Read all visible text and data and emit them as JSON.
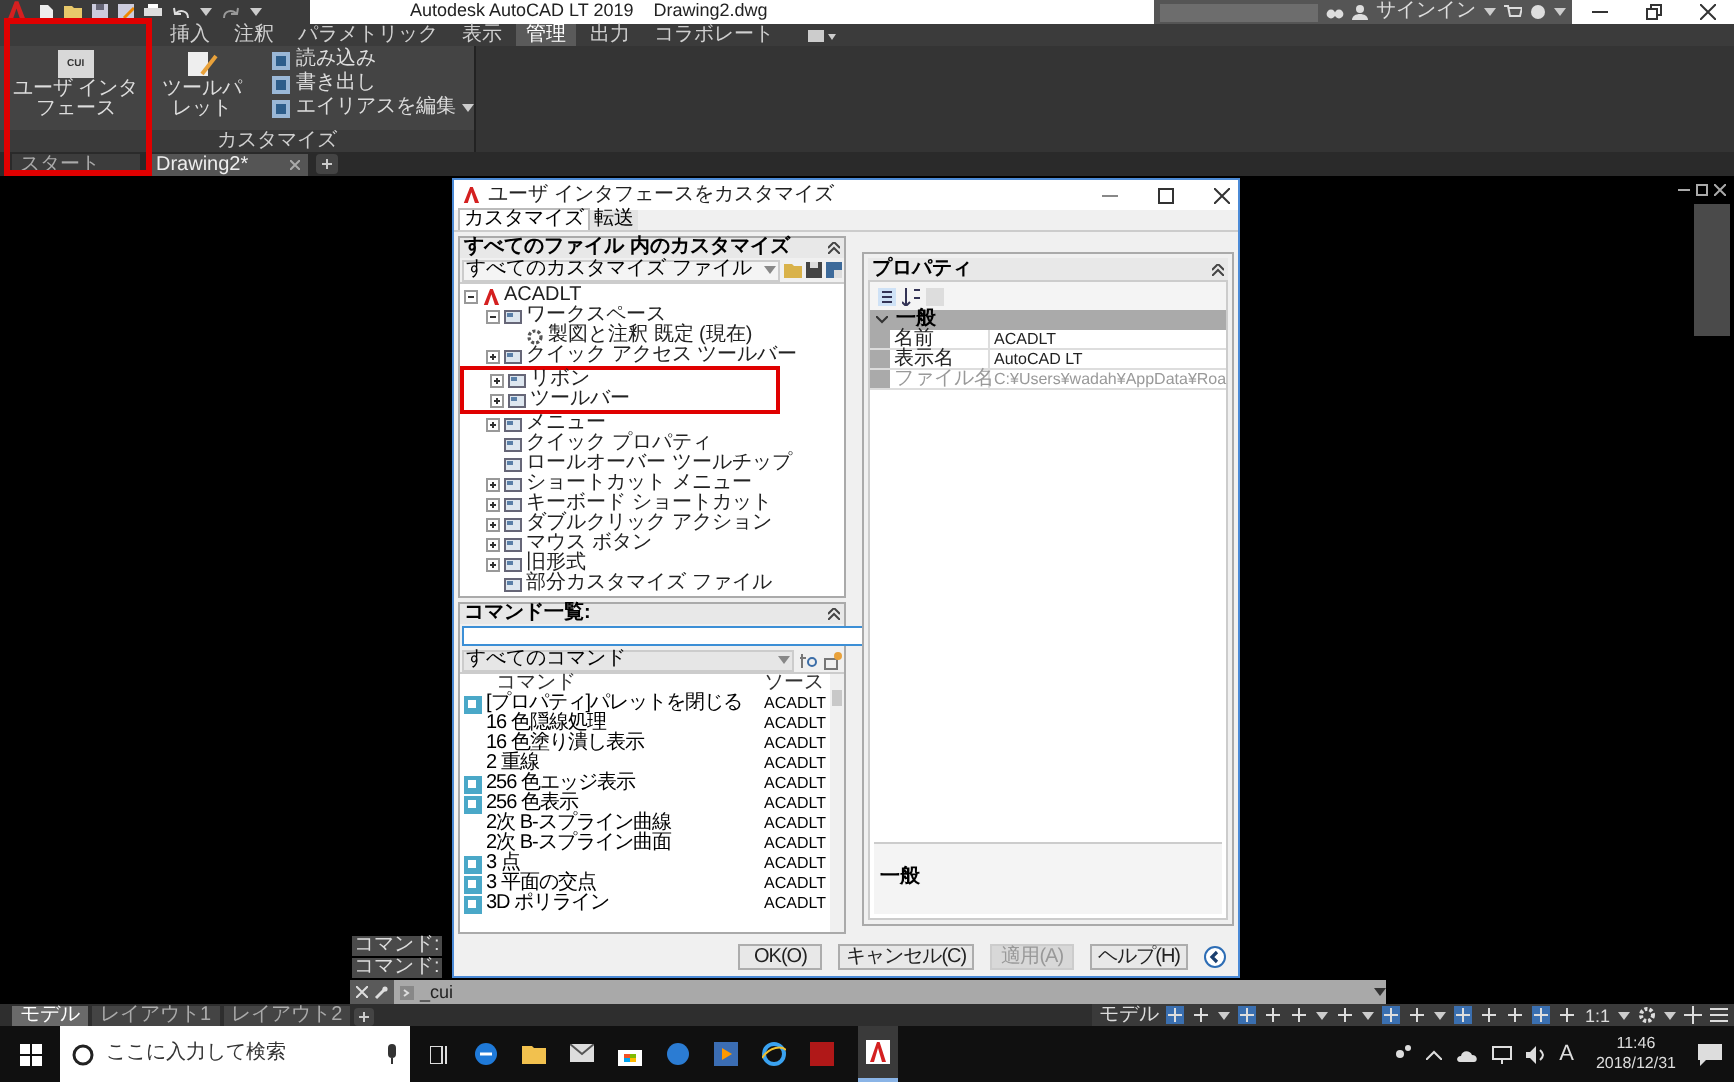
{
  "app_title": "Autodesk AutoCAD LT 2019",
  "document": "Drawing2.dwg",
  "sign_in": "サインイン",
  "ribbon_tabs": [
    {
      "label": "挿入",
      "selected": false
    },
    {
      "label": "注釈",
      "selected": false
    },
    {
      "label": "パラメトリック",
      "selected": false
    },
    {
      "label": "表示",
      "selected": false
    },
    {
      "label": "管理",
      "selected": true
    },
    {
      "label": "出力",
      "selected": false
    },
    {
      "label": "コラボレート",
      "selected": false
    }
  ],
  "ribbon_panel": {
    "title": "カスタマイズ",
    "large_buttons": [
      {
        "label": "ユーザ インタフェース",
        "icon_text": "CUI"
      },
      {
        "label": "ツールパレット"
      }
    ],
    "small_buttons": [
      {
        "label": "読み込み",
        "dropdown": false
      },
      {
        "label": "書き出し",
        "dropdown": false
      },
      {
        "label": "エイリアスを編集",
        "dropdown": true
      }
    ]
  },
  "file_tabs": [
    {
      "label": "スタート",
      "selected": false,
      "closable": false
    },
    {
      "label": "Drawing2*",
      "selected": true,
      "closable": true
    }
  ],
  "dialog": {
    "title": "ユーザ インタフェースをカスタマイズ",
    "tabs": [
      {
        "label": "カスタマイズ",
        "selected": true
      },
      {
        "label": "転送",
        "selected": false
      }
    ],
    "customize_panel": {
      "title": "すべてのファイル 内のカスタマイズ",
      "file_filter": "すべてのカスタマイズ ファイル",
      "tree": [
        {
          "label": "ACADLT",
          "expanded": true,
          "children": [
            {
              "label": "ワークスペース",
              "expanded": true,
              "children": [
                {
                  "label": "製図と注釈 既定 (現在)"
                }
              ]
            },
            {
              "label": "クイック アクセス ツールバー",
              "expanded": false
            },
            {
              "label": "リボン",
              "expanded": false
            },
            {
              "label": "ツールバー",
              "expanded": false
            },
            {
              "label": "メニュー",
              "expanded": false
            },
            {
              "label": "クイック プロパティ"
            },
            {
              "label": "ロールオーバー ツールチップ"
            },
            {
              "label": "ショートカット メニュー",
              "expanded": false
            },
            {
              "label": "キーボード ショートカット",
              "expanded": false
            },
            {
              "label": "ダブルクリック アクション",
              "expanded": false
            },
            {
              "label": "マウス ボタン",
              "expanded": false
            },
            {
              "label": "旧形式",
              "expanded": false
            },
            {
              "label": "部分カスタマイズ ファイル"
            }
          ]
        }
      ]
    },
    "command_panel": {
      "title": "コマンド一覧:",
      "filter": "すべてのコマンド",
      "columns": [
        "コマンド",
        "ソース"
      ],
      "rows": [
        {
          "name": "[プロパティ]パレットを閉じる",
          "source": "ACADLT",
          "has_icon": true
        },
        {
          "name": "16 色隠線処理",
          "source": "ACADLT",
          "has_icon": false
        },
        {
          "name": "16 色塗り潰し表示",
          "source": "ACADLT",
          "has_icon": false
        },
        {
          "name": "2 重線",
          "source": "ACADLT",
          "has_icon": false
        },
        {
          "name": "256 色エッジ表示",
          "source": "ACADLT",
          "has_icon": true
        },
        {
          "name": "256 色表示",
          "source": "ACADLT",
          "has_icon": true
        },
        {
          "name": "2次 B-スプライン曲線",
          "source": "ACADLT",
          "has_icon": false
        },
        {
          "name": "2次 B-スプライン曲面",
          "source": "ACADLT",
          "has_icon": false
        },
        {
          "name": "3 点",
          "source": "ACADLT",
          "has_icon": true
        },
        {
          "name": "3 平面の交点",
          "source": "ACADLT",
          "has_icon": true
        },
        {
          "name": "3D ポリライン",
          "source": "ACADLT",
          "has_icon": true
        }
      ]
    },
    "properties_panel": {
      "title": "プロパティ",
      "section": {
        "label": "一般",
        "expanded": true
      },
      "rows": [
        {
          "name": "名前",
          "value": "ACADLT",
          "disabled": false
        },
        {
          "name": "表示名",
          "value": "AutoCAD LT",
          "disabled": false
        },
        {
          "name": "ファイル名",
          "value": "C:¥Users¥wadah¥AppData¥Roa",
          "disabled": true
        }
      ],
      "description_title": "一般"
    },
    "buttons": [
      {
        "label": "OK(O)",
        "disabled": false
      },
      {
        "label": "キャンセル(C)",
        "disabled": false
      },
      {
        "label": "適用(A)",
        "disabled": true
      },
      {
        "label": "ヘルプ(H)",
        "disabled": false
      }
    ]
  },
  "command_history": [
    "コマンド:",
    "コマンド:"
  ],
  "command_input": "_cui",
  "layout_tabs": [
    {
      "label": "モデル",
      "selected": true
    },
    {
      "label": "レイアウト1",
      "selected": false
    },
    {
      "label": "レイアウト2",
      "selected": false
    }
  ],
  "status_bar": {
    "model": "モデル",
    "scale": "1:1"
  },
  "taskbar": {
    "search_placeholder": "ここに入力して検索",
    "ime": "A",
    "time": "11:46",
    "date": "2018/12/31"
  }
}
